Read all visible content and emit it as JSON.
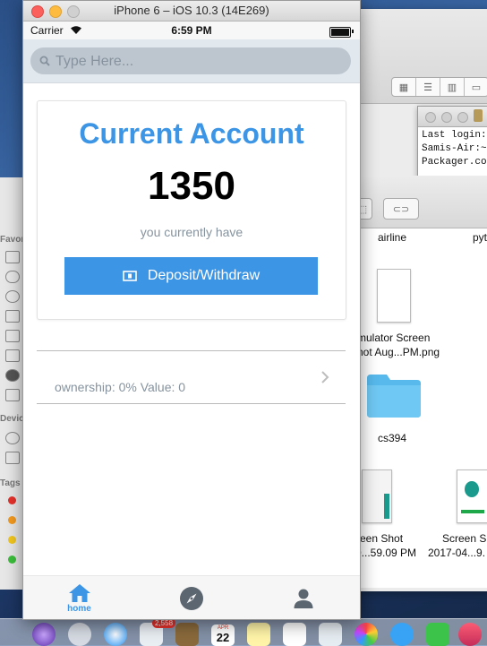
{
  "simulator": {
    "title": "iPhone 6 – iOS 10.3 (14E269)"
  },
  "status_bar": {
    "carrier": "Carrier",
    "time": "6:59 PM"
  },
  "search": {
    "placeholder": "Type Here..."
  },
  "account_card": {
    "title": "Current Account",
    "amount": "1350",
    "subtitle": "you currently have",
    "button_label": "Deposit/Withdraw"
  },
  "list": {
    "rows": [
      {
        "text": "ownership: 0% Value: 0"
      }
    ]
  },
  "tab_bar": {
    "tabs": [
      {
        "label": "home",
        "icon": "home-icon",
        "active": true
      },
      {
        "label": "",
        "icon": "compass-icon",
        "active": false
      },
      {
        "label": "",
        "icon": "person-icon",
        "active": false
      }
    ]
  },
  "background": {
    "terminal_lines": [
      "Last login:",
      "Samis-Air:~",
      "Packager.co"
    ],
    "finder_files": [
      {
        "label": "airline"
      },
      {
        "label": "pyt"
      },
      {
        "label": "mulator Screen"
      },
      {
        "label": "hot Aug...PM.png"
      },
      {
        "label": "cs394"
      },
      {
        "label": "reen Shot"
      },
      {
        "label": "0...59.09 PM"
      },
      {
        "label": "Screen S"
      },
      {
        "label": "2017-04...9."
      }
    ],
    "sidebar_labels": [
      "Favor",
      "Devic",
      "Tags"
    ],
    "dock_badge": "2,558",
    "dock_date": {
      "month": "APR",
      "day": "22"
    }
  },
  "colors": {
    "accent": "#3d95e6",
    "muted_text": "#86939e",
    "search_bg": "#e1e8ee"
  }
}
